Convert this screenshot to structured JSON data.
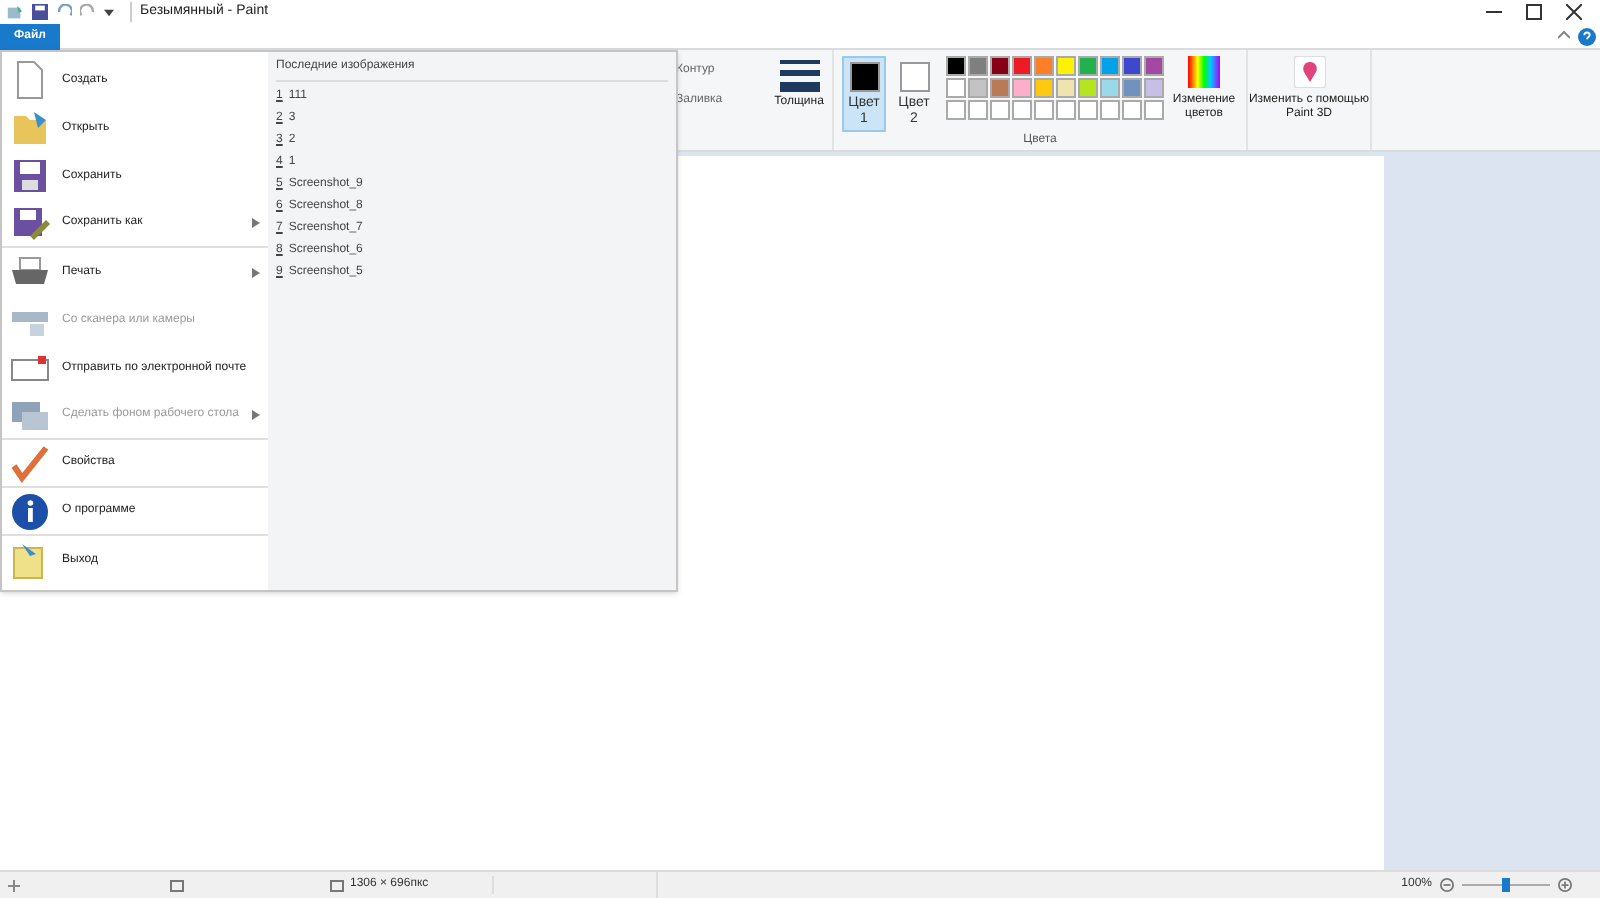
{
  "window": {
    "title": "Безымянный - Paint"
  },
  "file_tab": {
    "label": "Файл",
    "selected": true
  },
  "file_menu": {
    "items": [
      {
        "kind": "new",
        "label": "Создать",
        "disabled": false,
        "submenu": false,
        "divider": false
      },
      {
        "kind": "open",
        "label": "Открыть",
        "disabled": false,
        "submenu": false,
        "divider": false
      },
      {
        "kind": "save",
        "label": "Сохранить",
        "disabled": false,
        "submenu": false,
        "divider": false
      },
      {
        "kind": "saveas",
        "label": "Сохранить как",
        "disabled": false,
        "submenu": true,
        "divider": true
      },
      {
        "kind": "print",
        "label": "Печать",
        "disabled": false,
        "submenu": true,
        "divider": false
      },
      {
        "kind": "scanner",
        "label": "Со сканера или камеры",
        "disabled": true,
        "submenu": false,
        "divider": false
      },
      {
        "kind": "email",
        "label": "Отправить по электронной почте",
        "disabled": false,
        "submenu": false,
        "divider": false
      },
      {
        "kind": "desktop",
        "label": "Сделать фоном рабочего стола",
        "disabled": true,
        "submenu": true,
        "divider": true
      },
      {
        "kind": "properties",
        "label": "Свойства",
        "disabled": false,
        "submenu": false,
        "divider": true
      },
      {
        "kind": "about",
        "label": "О программе",
        "disabled": false,
        "submenu": false,
        "divider": true
      },
      {
        "kind": "exit",
        "label": "Выход",
        "disabled": false,
        "submenu": false,
        "divider": false
      }
    ],
    "recent_title": "Последние изображения",
    "recent": [
      {
        "number": "1",
        "name": "111"
      },
      {
        "number": "2",
        "name": "3"
      },
      {
        "number": "3",
        "name": "2"
      },
      {
        "number": "4",
        "name": "1"
      },
      {
        "number": "5",
        "name": "Screenshot_9"
      },
      {
        "number": "6",
        "name": "Screenshot_8"
      },
      {
        "number": "7",
        "name": "Screenshot_7"
      },
      {
        "number": "8",
        "name": "Screenshot_6"
      },
      {
        "number": "9",
        "name": "Screenshot_5"
      }
    ]
  },
  "ribbon": {
    "outline": "Контур",
    "fill": "Заливка",
    "thickness": "Толщина",
    "color1": {
      "label": "Цвет",
      "sub": "1",
      "selected": true
    },
    "color2": {
      "label": "Цвет",
      "sub": "2",
      "selected": false
    },
    "palette": [
      {
        "color": "#000000"
      },
      {
        "color": "#7f7f7f"
      },
      {
        "color": "#880015"
      },
      {
        "color": "#ed1c24"
      },
      {
        "color": "#ff7f27"
      },
      {
        "color": "#fff200"
      },
      {
        "color": "#22b14c"
      },
      {
        "color": "#00a2e8"
      },
      {
        "color": "#3f48cc"
      },
      {
        "color": "#a349a4"
      },
      {
        "color": "#ffffff"
      },
      {
        "color": "#c3c3c3"
      },
      {
        "color": "#b97a57"
      },
      {
        "color": "#ffaec9"
      },
      {
        "color": "#ffc90e"
      },
      {
        "color": "#efe4b0"
      },
      {
        "color": "#b5e61d"
      },
      {
        "color": "#99d9ea"
      },
      {
        "color": "#7092be"
      },
      {
        "color": "#c8bfe7"
      }
    ],
    "edit_colors": "Изменение цветов",
    "paint3d": "Изменить с помощью Paint 3D",
    "group_label": "Цвета"
  },
  "status_bar": {
    "size": "1306 × 696пкс",
    "zoom": "100%",
    "zoom_slider": {
      "level": 0.5
    }
  }
}
